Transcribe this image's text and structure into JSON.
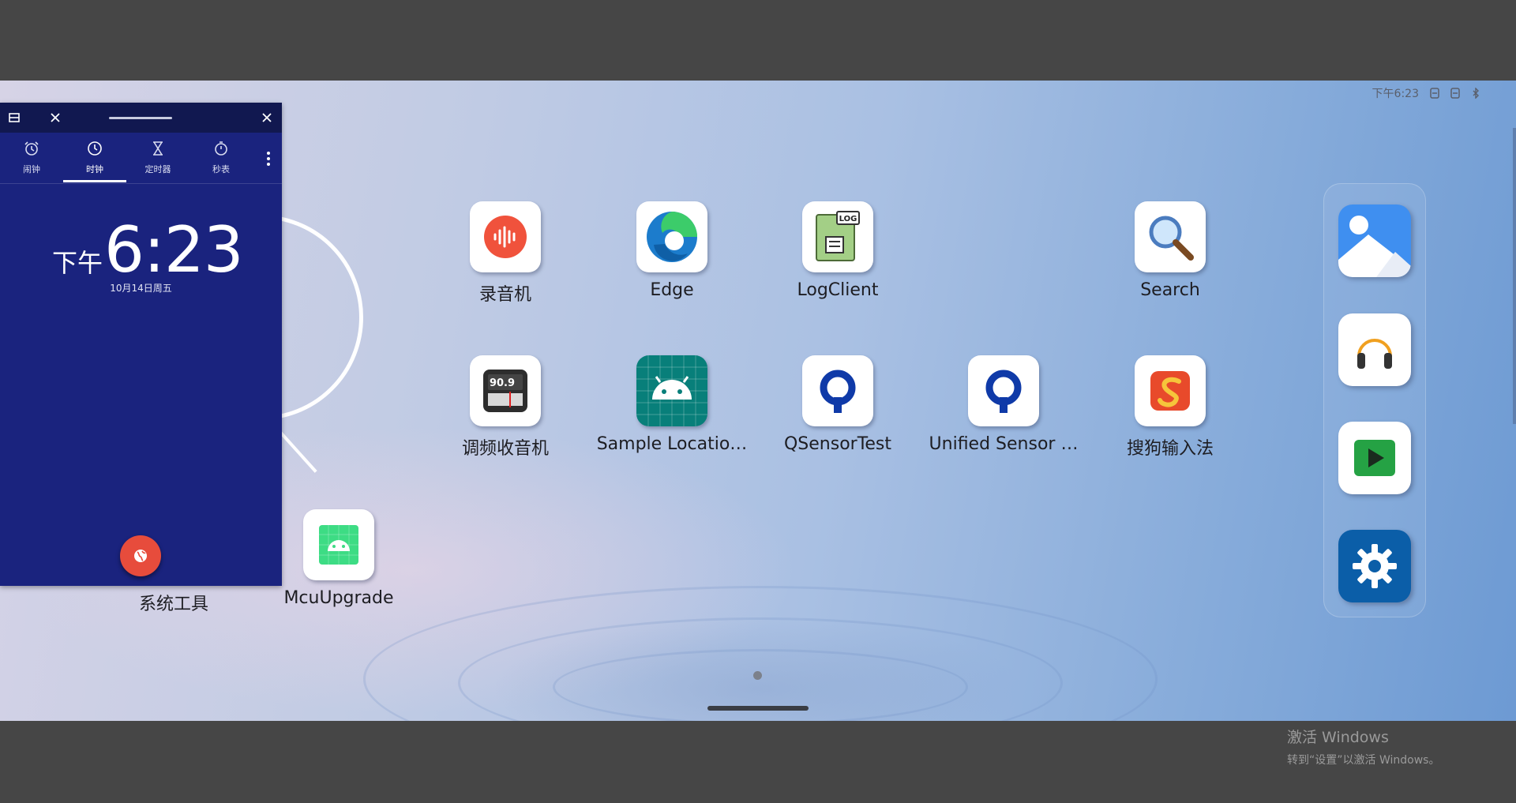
{
  "status_bar": {
    "time": "下午6:23"
  },
  "apps": [
    {
      "label": "录音机",
      "icon": "recorder-icon",
      "color": "#f0523c"
    },
    {
      "label": "Edge",
      "icon": "edge-icon",
      "color": "#1c7ccc"
    },
    {
      "label": "LogClient",
      "icon": "log-icon",
      "badge": "LOG",
      "color": "#8fbf6b"
    },
    {
      "label": "Search",
      "icon": "magnifier-icon"
    },
    {
      "label": "调频收音机",
      "icon": "radio-icon",
      "display": "90.9"
    },
    {
      "label": "Sample Locatio…",
      "icon": "android-icon",
      "color": "#087f7a"
    },
    {
      "label": "QSensorTest",
      "icon": "qualcomm-icon",
      "color": "#0f3aa8"
    },
    {
      "label": "Unified Sensor …",
      "icon": "qualcomm-icon",
      "color": "#0f3aa8"
    },
    {
      "label": "搜狗输入法",
      "icon": "sogou-icon",
      "color": "#e84a2b"
    },
    {
      "label": "McuUpgrade",
      "icon": "android-icon",
      "color": "#3ddc84"
    }
  ],
  "system_tools_label": "系统工具",
  "dock": [
    {
      "icon": "gallery-icon",
      "color": "#3f8ff0"
    },
    {
      "icon": "headphones-icon",
      "color": "#f0a020"
    },
    {
      "icon": "video-player-icon",
      "color": "#25a244"
    },
    {
      "icon": "settings-icon",
      "color": "#0b5ea8"
    }
  ],
  "clock_window": {
    "tabs": [
      {
        "label": "闹钟",
        "icon": "alarm-icon"
      },
      {
        "label": "时钟",
        "icon": "clock-icon",
        "active": true
      },
      {
        "label": "定时器",
        "icon": "hourglass-icon"
      },
      {
        "label": "秒表",
        "icon": "stopwatch-icon"
      }
    ],
    "ampm": "下午",
    "time": "6:23",
    "date": "10月14日周五",
    "background": "#1a237e"
  },
  "watermark": {
    "line1": "激活 Windows",
    "line2": "转到“设置”以激活 Windows。"
  }
}
